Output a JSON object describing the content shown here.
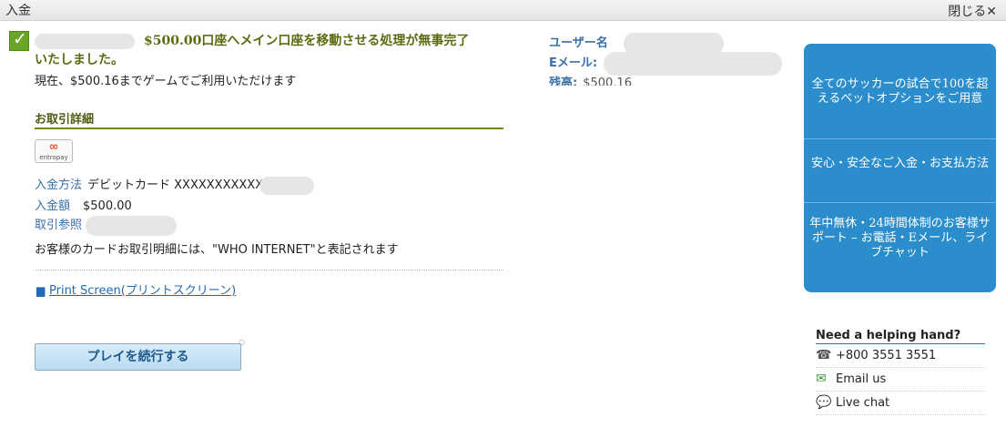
{
  "window": {
    "title": "入金",
    "close_label": "閉じる✕"
  },
  "success": {
    "line1": "$500.00口座へメイン口座を移動させる処理が無事完了",
    "line2": "いたしました。",
    "available": "現在、$500.16までゲームでご利用いただけます"
  },
  "details": {
    "title": "お取引詳細",
    "logo": {
      "symbol": "∞",
      "name": "entropay"
    },
    "method_label": "入金方法",
    "method_value": "デビットカード XXXXXXXXXXX",
    "amount_label": "入金額",
    "amount_value": "$500.00",
    "ref_label": "取引参照",
    "note": "お客様のカードお取引明細には、\"WHO INTERNET\"と表記されます",
    "print_label": "Print Screen(プリントスクリーン)",
    "continue_label": "プレイを続行する"
  },
  "user": {
    "user_label": "ユーザー名",
    "email_label": "Eメール:",
    "balance_label": "残高:",
    "balance_value": "$500.16"
  },
  "promo": {
    "items": [
      "全てのサッカーの試合で100を超えるベットオプションをご用意",
      "安心・安全なご入金・お支払方法",
      "年中無休・24時間体制のお客様サポート – お電話・Eメール、ライブチャット"
    ]
  },
  "help": {
    "title": "Need a helping hand?",
    "phone": "+800 3551 3551",
    "email": "Email us",
    "chat": "Live chat"
  },
  "icons": {
    "check": "check-icon",
    "print": "printer-icon",
    "phone": "headset-icon",
    "email": "email-icon",
    "chat": "chat-bubble-icon"
  },
  "colors": {
    "accent_blue": "#2b8dcb",
    "success_green": "#6aa52a",
    "title_olive": "#5e6a12"
  }
}
